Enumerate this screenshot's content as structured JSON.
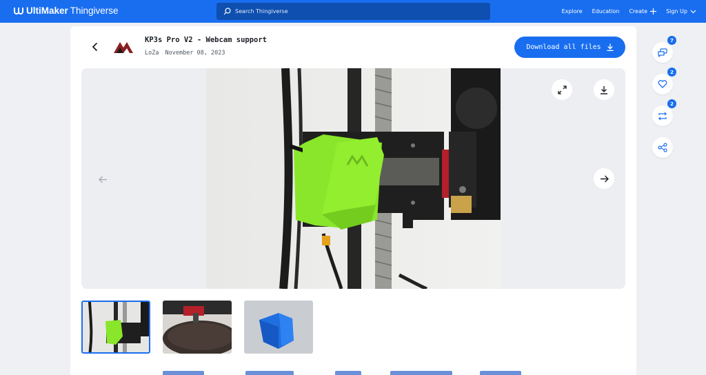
{
  "header": {
    "brand_bold": "UltiMaker",
    "brand_light": "Thingiverse",
    "search_placeholder": "Search Thingiverse",
    "nav": {
      "explore": "Explore",
      "education": "Education",
      "create": "Create",
      "signup": "Sign Up"
    }
  },
  "thing": {
    "title": "KP3s Pro V2 - Webcam support",
    "author": "LoZa",
    "date": "November 08, 2023",
    "download_label": "Download all files"
  },
  "actions": {
    "comments_count": "7",
    "likes_count": "2",
    "remixes_count": "2"
  },
  "colors": {
    "brand": "#196ef0",
    "accent_green": "#8ae62a"
  },
  "gallery": {
    "thumbnails": [
      "thumbnail-1",
      "thumbnail-2",
      "thumbnail-3"
    ],
    "selected": 0
  }
}
